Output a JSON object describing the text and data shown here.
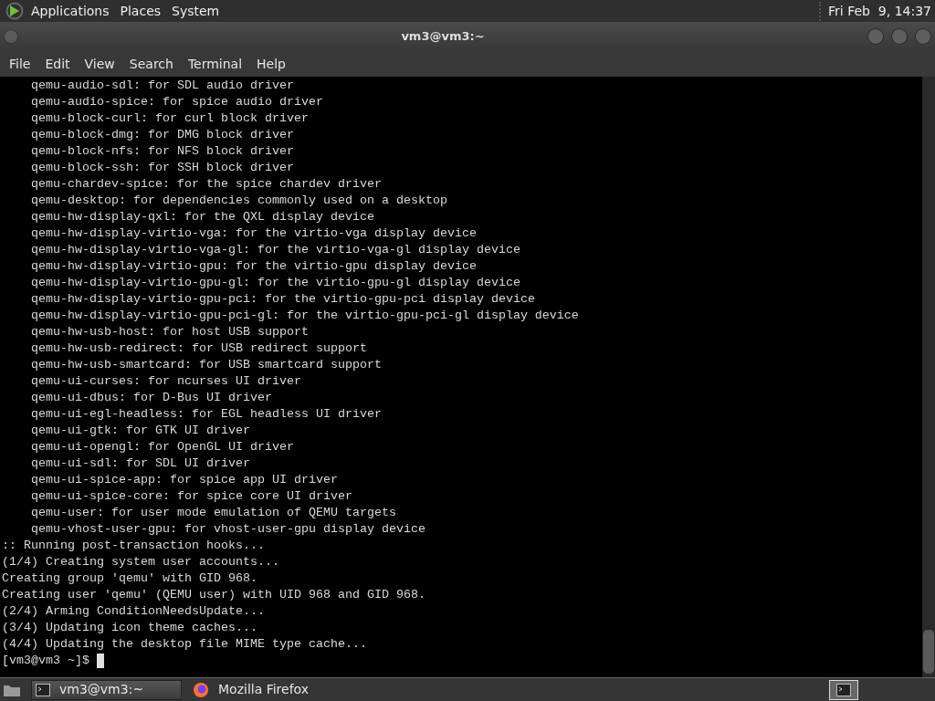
{
  "top_panel": {
    "menus": [
      "Applications",
      "Places",
      "System"
    ],
    "clock": "Fri Feb  9, 14:37"
  },
  "window": {
    "title": "vm3@vm3:~"
  },
  "menubar": [
    "File",
    "Edit",
    "View",
    "Search",
    "Terminal",
    "Help"
  ],
  "terminal": {
    "lines": [
      {
        "kind": "package",
        "text": "qemu-audio-sdl: for SDL audio driver"
      },
      {
        "kind": "package",
        "text": "qemu-audio-spice: for spice audio driver"
      },
      {
        "kind": "package",
        "text": "qemu-block-curl: for curl block driver"
      },
      {
        "kind": "package",
        "text": "qemu-block-dmg: for DMG block driver"
      },
      {
        "kind": "package",
        "text": "qemu-block-nfs: for NFS block driver"
      },
      {
        "kind": "package",
        "text": "qemu-block-ssh: for SSH block driver"
      },
      {
        "kind": "package",
        "text": "qemu-chardev-spice: for the spice chardev driver"
      },
      {
        "kind": "package",
        "text": "qemu-desktop: for dependencies commonly used on a desktop"
      },
      {
        "kind": "package",
        "text": "qemu-hw-display-qxl: for the QXL display device"
      },
      {
        "kind": "package",
        "text": "qemu-hw-display-virtio-vga: for the virtio-vga display device"
      },
      {
        "kind": "package",
        "text": "qemu-hw-display-virtio-vga-gl: for the virtio-vga-gl display device"
      },
      {
        "kind": "package",
        "text": "qemu-hw-display-virtio-gpu: for the virtio-gpu display device"
      },
      {
        "kind": "package",
        "text": "qemu-hw-display-virtio-gpu-gl: for the virtio-gpu-gl display device"
      },
      {
        "kind": "package",
        "text": "qemu-hw-display-virtio-gpu-pci: for the virtio-gpu-pci display device"
      },
      {
        "kind": "package",
        "text": "qemu-hw-display-virtio-gpu-pci-gl: for the virtio-gpu-pci-gl display device"
      },
      {
        "kind": "package",
        "text": "qemu-hw-usb-host: for host USB support"
      },
      {
        "kind": "package",
        "text": "qemu-hw-usb-redirect: for USB redirect support"
      },
      {
        "kind": "package",
        "text": "qemu-hw-usb-smartcard: for USB smartcard support"
      },
      {
        "kind": "package",
        "text": "qemu-ui-curses: for ncurses UI driver"
      },
      {
        "kind": "package",
        "text": "qemu-ui-dbus: for D-Bus UI driver"
      },
      {
        "kind": "package",
        "text": "qemu-ui-egl-headless: for EGL headless UI driver"
      },
      {
        "kind": "package",
        "text": "qemu-ui-gtk: for GTK UI driver"
      },
      {
        "kind": "package",
        "text": "qemu-ui-opengl: for OpenGL UI driver"
      },
      {
        "kind": "package",
        "text": "qemu-ui-sdl: for SDL UI driver"
      },
      {
        "kind": "package",
        "text": "qemu-ui-spice-app: for spice app UI driver"
      },
      {
        "kind": "package",
        "text": "qemu-ui-spice-core: for spice core UI driver"
      },
      {
        "kind": "package",
        "text": "qemu-user: for user mode emulation of QEMU targets"
      },
      {
        "kind": "package",
        "text": "qemu-vhost-user-gpu: for vhost-user-gpu display device"
      },
      {
        "kind": "output",
        "text": ":: Running post-transaction hooks..."
      },
      {
        "kind": "output",
        "text": "(1/4) Creating system user accounts..."
      },
      {
        "kind": "output",
        "text": "Creating group 'qemu' with GID 968."
      },
      {
        "kind": "output",
        "text": "Creating user 'qemu' (QEMU user) with UID 968 and GID 968."
      },
      {
        "kind": "output",
        "text": "(2/4) Arming ConditionNeedsUpdate..."
      },
      {
        "kind": "output",
        "text": "(3/4) Updating icon theme caches..."
      },
      {
        "kind": "output",
        "text": "(4/4) Updating the desktop file MIME type cache..."
      }
    ],
    "prompt": "[vm3@vm3 ~]$"
  },
  "taskbar": {
    "tasks": [
      {
        "label": "vm3@vm3:~",
        "selected": true
      },
      {
        "label": "Mozilla Firefox",
        "selected": false
      }
    ]
  }
}
